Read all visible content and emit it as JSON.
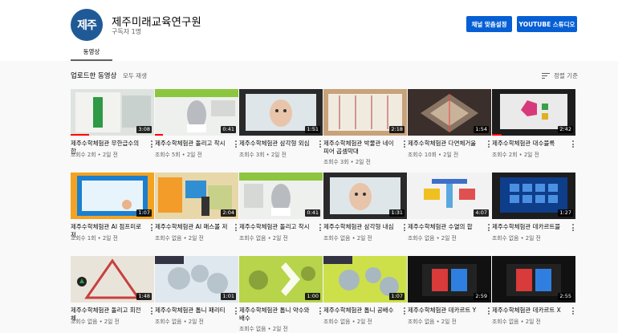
{
  "channel": {
    "avatar_text": "제주",
    "name": "제주미래교육연구원",
    "subscribers": "구독자 1명",
    "customize_button": "채널 맞춤설정",
    "studio_button": "YOUTUBE 스튜디오"
  },
  "tabs": {
    "videos": "동영상"
  },
  "shelf": {
    "title": "업로드한 동영상",
    "play_all": "모두 재생",
    "sort": "정렬 기준"
  },
  "colors": {
    "accent": "#065fd4",
    "avatar": "#1f5a96",
    "progress": "#ff0000"
  },
  "videos": [
    {
      "title": "제주수학체험관 무한급수의 합",
      "views": "조회수 2회",
      "age": "2일 전",
      "duration": "3:08",
      "progress": 0.22
    },
    {
      "title": "제주수학체험관 돌리고 착시",
      "views": "조회수 5회",
      "age": "2일 전",
      "duration": "0:41",
      "progress": 0.1
    },
    {
      "title": "제주수학체험관 삼각형 외심",
      "views": "조회수 3회",
      "age": "2일 전",
      "duration": "1:51",
      "progress": 0
    },
    {
      "title": "제주수학체험관 박물관 네이피어 곱셈막대",
      "views": "조회수 3회",
      "age": "2일 전",
      "duration": "2:18",
      "progress": 0
    },
    {
      "title": "제주수학체험관 다면체거울",
      "views": "조회수 10회",
      "age": "2일 전",
      "duration": "1:54",
      "progress": 0
    },
    {
      "title": "제주수학체험관 대수블록",
      "views": "조회수 2회",
      "age": "2일 전",
      "duration": "2:42",
      "progress": 0.12
    },
    {
      "title": "제주수학체험관 AI 점프미로저",
      "views": "조회수 1회",
      "age": "2일 전",
      "duration": "1:07",
      "progress": 0
    },
    {
      "title": "제주수학체험관 AI 매스볼 저",
      "views": "조회수 없음",
      "age": "2일 전",
      "duration": "2:04",
      "progress": 0
    },
    {
      "title": "제주수학체험관 돌리고 착시",
      "views": "조회수 없음",
      "age": "2일 전",
      "duration": "0:41",
      "progress": 0
    },
    {
      "title": "제주수학체험관 삼각형 내심",
      "views": "조회수 없음",
      "age": "2일 전",
      "duration": "1:31",
      "progress": 0
    },
    {
      "title": "제주수학체험관 수열의 합",
      "views": "조회수 없음",
      "age": "2일 전",
      "duration": "4:07",
      "progress": 0
    },
    {
      "title": "제주수학체험관 데카르트블",
      "views": "조회수 없음",
      "age": "2일 전",
      "duration": "1:27",
      "progress": 0
    },
    {
      "title": "제주수학체험관 돌리고 회전체",
      "views": "조회수 없음",
      "age": "2일 전",
      "duration": "1:48",
      "progress": 0
    },
    {
      "title": "제주수학체험관 톱니 패리티",
      "views": "조회수 없음",
      "age": "2일 전",
      "duration": "1:01",
      "progress": 0
    },
    {
      "title": "제주수학체험관 톱니 약수와 배수",
      "views": "조회수 없음",
      "age": "2일 전",
      "duration": "1:00",
      "progress": 0
    },
    {
      "title": "제주수학체험관 톱니 공배수",
      "views": "조회수 없음",
      "age": "2일 전",
      "duration": "1:07",
      "progress": 0
    },
    {
      "title": "제주수학체험관 데카르트 Y",
      "views": "조회수 없음",
      "age": "2일 전",
      "duration": "2:59",
      "progress": 0
    },
    {
      "title": "제주수학체험관 데카르트 X",
      "views": "조회수 없음",
      "age": "2일 전",
      "duration": "2:55",
      "progress": 0
    }
  ]
}
